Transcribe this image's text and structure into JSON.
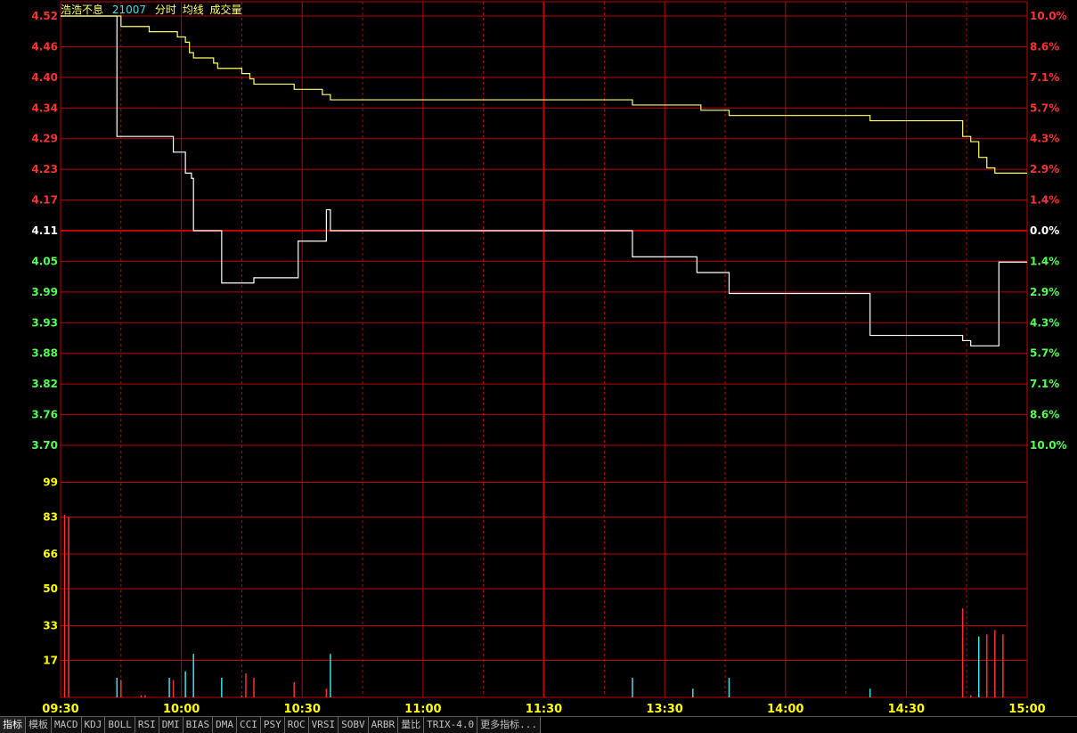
{
  "header": {
    "stock_name": "浩浩不息",
    "code": "21007",
    "view_label": "分时",
    "avg_label": "均线",
    "volume_label": "成交量"
  },
  "colors": {
    "background": "#000000",
    "grid": "#c00000",
    "price_line": "#ffffff",
    "avg_line": "#ffff66",
    "up": "#ff3232",
    "down": "#54ff54",
    "neutral": "#ffffff",
    "volume_axis": "#ffff00",
    "time_label": "#ffff00",
    "vol_up": "#ff3030",
    "vol_down": "#40e0e0"
  },
  "tabs": [
    "指标",
    "模板",
    "MACD",
    "KDJ",
    "BOLL",
    "RSI",
    "DMI",
    "BIAS",
    "DMA",
    "CCI",
    "PSY",
    "ROC",
    "VRSI",
    "SOBV",
    "ARBR",
    "量比",
    "TRIX-4.0",
    "更多指标..."
  ],
  "chart_data": [
    {
      "type": "line",
      "title": "",
      "prev_close": 4.11,
      "ylim": [
        3.7,
        4.52
      ],
      "y_ticks": [
        "4.52",
        "4.46",
        "4.40",
        "4.34",
        "4.29",
        "4.23",
        "4.17",
        "4.11",
        "4.05",
        "3.99",
        "3.93",
        "3.88",
        "3.82",
        "3.76",
        "3.70"
      ],
      "pct_ticks": [
        "10.0%",
        "8.6%",
        "7.1%",
        "5.7%",
        "4.3%",
        "2.9%",
        "1.4%",
        "0.0%",
        "1.4%",
        "2.9%",
        "4.3%",
        "5.7%",
        "7.1%",
        "8.6%",
        "10.0%"
      ],
      "x_ticks": [
        "09:30",
        "10:00",
        "10:30",
        "11:00",
        "11:30",
        "13:30",
        "14:00",
        "14:30",
        "15:00"
      ],
      "xlim_minutes": [
        0,
        240
      ],
      "series": [
        {
          "name": "分时",
          "points": [
            [
              0,
              4.52
            ],
            [
              1,
              4.52
            ],
            [
              2,
              4.52
            ],
            [
              3,
              4.52
            ],
            [
              4,
              4.52
            ],
            [
              5,
              4.52
            ],
            [
              6,
              4.52
            ],
            [
              7,
              4.52
            ],
            [
              8,
              4.52
            ],
            [
              9,
              4.52
            ],
            [
              10,
              4.52
            ],
            [
              11,
              4.52
            ],
            [
              12,
              4.52
            ],
            [
              13,
              4.52
            ],
            [
              14,
              4.29
            ],
            [
              27,
              4.29
            ],
            [
              28,
              4.26
            ],
            [
              30,
              4.26
            ],
            [
              31,
              4.22
            ],
            [
              32,
              4.22
            ],
            [
              32.5,
              4.21
            ],
            [
              33,
              4.11
            ],
            [
              38,
              4.11
            ],
            [
              40,
              4.01
            ],
            [
              47,
              4.01
            ],
            [
              48,
              4.02
            ],
            [
              58,
              4.02
            ],
            [
              59,
              4.09
            ],
            [
              65,
              4.09
            ],
            [
              66,
              4.15
            ],
            [
              67,
              4.11
            ],
            [
              141,
              4.11
            ],
            [
              142,
              4.06
            ],
            [
              157,
              4.06
            ],
            [
              158,
              4.03
            ],
            [
              165,
              4.03
            ],
            [
              166,
              3.99
            ],
            [
              200,
              3.99
            ],
            [
              201,
              3.91
            ],
            [
              223,
              3.91
            ],
            [
              224,
              3.9
            ],
            [
              226,
              3.89
            ],
            [
              232,
              3.89
            ],
            [
              233,
              4.05
            ],
            [
              240,
              4.05
            ]
          ]
        },
        {
          "name": "均线",
          "points": [
            [
              0,
              4.52
            ],
            [
              13,
              4.52
            ],
            [
              15,
              4.5
            ],
            [
              21,
              4.5
            ],
            [
              22,
              4.49
            ],
            [
              27,
              4.49
            ],
            [
              29,
              4.48
            ],
            [
              31,
              4.47
            ],
            [
              32,
              4.45
            ],
            [
              33,
              4.44
            ],
            [
              37,
              4.44
            ],
            [
              38,
              4.43
            ],
            [
              39,
              4.42
            ],
            [
              44,
              4.42
            ],
            [
              45,
              4.41
            ],
            [
              47,
              4.4
            ],
            [
              48,
              4.39
            ],
            [
              57,
              4.39
            ],
            [
              58,
              4.38
            ],
            [
              64,
              4.38
            ],
            [
              65,
              4.37
            ],
            [
              67,
              4.36
            ],
            [
              141,
              4.36
            ],
            [
              142,
              4.35
            ],
            [
              158,
              4.35
            ],
            [
              159,
              4.34
            ],
            [
              165,
              4.34
            ],
            [
              166,
              4.33
            ],
            [
              200,
              4.33
            ],
            [
              201,
              4.32
            ],
            [
              223,
              4.32
            ],
            [
              224,
              4.29
            ],
            [
              226,
              4.28
            ],
            [
              228,
              4.25
            ],
            [
              230,
              4.23
            ],
            [
              232,
              4.22
            ],
            [
              240,
              4.22
            ]
          ]
        }
      ]
    },
    {
      "type": "bar",
      "title": "",
      "ylim": [
        0,
        116
      ],
      "y_ticks": [
        "99",
        "83",
        "66",
        "50",
        "33",
        "17"
      ],
      "bars": [
        {
          "x": 1,
          "v": 84,
          "dir": "up"
        },
        {
          "x": 2,
          "v": 83,
          "dir": "up"
        },
        {
          "x": 14,
          "v": 9,
          "dir": "down"
        },
        {
          "x": 15,
          "v": 8,
          "dir": "up"
        },
        {
          "x": 20,
          "v": 1,
          "dir": "up"
        },
        {
          "x": 21,
          "v": 1,
          "dir": "up"
        },
        {
          "x": 27,
          "v": 9,
          "dir": "down"
        },
        {
          "x": 28,
          "v": 8,
          "dir": "up"
        },
        {
          "x": 31,
          "v": 12,
          "dir": "down"
        },
        {
          "x": 33,
          "v": 20,
          "dir": "down"
        },
        {
          "x": 40,
          "v": 9,
          "dir": "down"
        },
        {
          "x": 45,
          "v": 1,
          "dir": "up"
        },
        {
          "x": 46,
          "v": 11,
          "dir": "up"
        },
        {
          "x": 48,
          "v": 9,
          "dir": "up"
        },
        {
          "x": 58,
          "v": 7,
          "dir": "up"
        },
        {
          "x": 66,
          "v": 4,
          "dir": "up"
        },
        {
          "x": 67,
          "v": 20,
          "dir": "down"
        },
        {
          "x": 142,
          "v": 9,
          "dir": "down"
        },
        {
          "x": 157,
          "v": 4,
          "dir": "down"
        },
        {
          "x": 166,
          "v": 9,
          "dir": "down"
        },
        {
          "x": 201,
          "v": 4,
          "dir": "down"
        },
        {
          "x": 224,
          "v": 41,
          "dir": "up"
        },
        {
          "x": 226,
          "v": 1,
          "dir": "up"
        },
        {
          "x": 228,
          "v": 28,
          "dir": "down"
        },
        {
          "x": 230,
          "v": 29,
          "dir": "up"
        },
        {
          "x": 232,
          "v": 31,
          "dir": "up"
        },
        {
          "x": 234,
          "v": 29,
          "dir": "up"
        }
      ]
    }
  ]
}
